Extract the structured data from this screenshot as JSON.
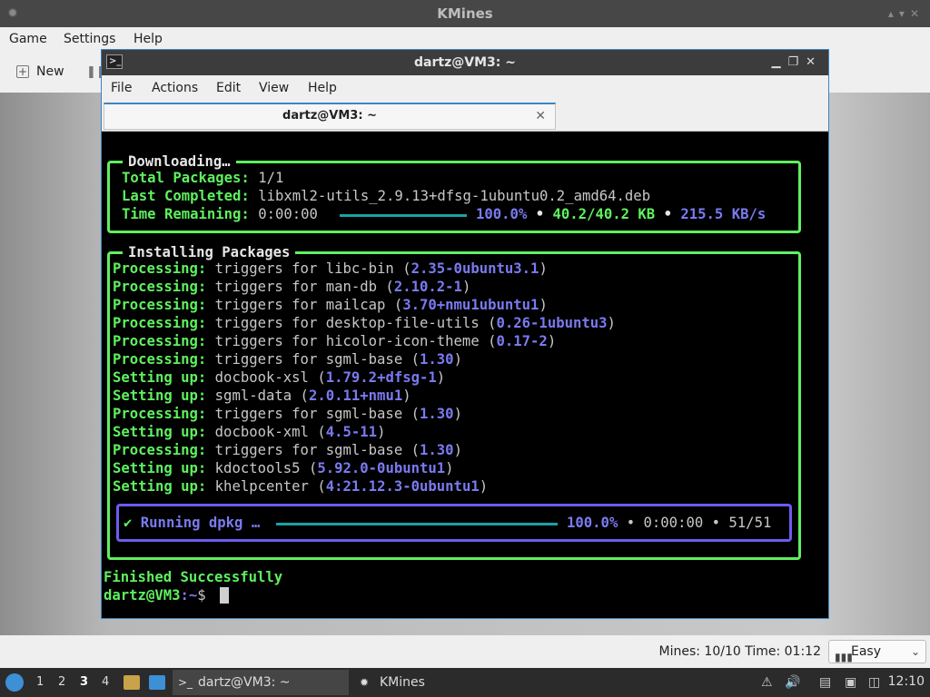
{
  "kmines": {
    "title": "KMines",
    "menu": [
      "Game",
      "Settings",
      "Help"
    ],
    "toolbar": {
      "new_label": "New"
    },
    "status": {
      "mines": "Mines: 10/10",
      "time": "Time: 01:12",
      "difficulty": "Easy"
    }
  },
  "terminal": {
    "title": "dartz@VM3: ~",
    "menu": [
      "File",
      "Actions",
      "Edit",
      "View",
      "Help"
    ],
    "tab_label": "dartz@VM3: ~",
    "download": {
      "title": "Downloading…",
      "total_label": "Total Packages:",
      "total_value": "1/1",
      "last_label": "Last Completed:",
      "last_value": "libxml2-utils_2.9.13+dfsg-1ubuntu0.2_amd64.deb",
      "remaining_label": "Time Remaining:",
      "remaining_value": "0:00:00",
      "percent": "100.0%",
      "size": "40.2/40.2 KB",
      "speed": "215.5 KB/s",
      "progress": 1.0
    },
    "install": {
      "title": "Installing Packages",
      "lines": [
        {
          "label": "Processing:",
          "text": "triggers for libc-bin (",
          "version": "2.35-0ubuntu3.1",
          "close": ")"
        },
        {
          "label": "Processing:",
          "text": "triggers for man-db (",
          "version": "2.10.2-1",
          "close": ")"
        },
        {
          "label": "Processing:",
          "text": "triggers for mailcap (",
          "version": "3.70+nmu1ubuntu1",
          "close": ")"
        },
        {
          "label": "Processing:",
          "text": "triggers for desktop-file-utils (",
          "version": "0.26-1ubuntu3",
          "close": ")"
        },
        {
          "label": "Processing:",
          "text": "triggers for hicolor-icon-theme (",
          "version": "0.17-2",
          "close": ")"
        },
        {
          "label": "Processing:",
          "text": "triggers for sgml-base (",
          "version": "1.30",
          "close": ")"
        },
        {
          "label": "Setting up:",
          "text": "docbook-xsl (",
          "version": "1.79.2+dfsg-1",
          "close": ")"
        },
        {
          "label": "Setting up:",
          "text": "sgml-data (",
          "version": "2.0.11+nmu1",
          "close": ")"
        },
        {
          "label": "Processing:",
          "text": "triggers for sgml-base (",
          "version": "1.30",
          "close": ")"
        },
        {
          "label": "Setting up:",
          "text": "docbook-xml (",
          "version": "4.5-11",
          "close": ")"
        },
        {
          "label": "Processing:",
          "text": "triggers for sgml-base (",
          "version": "1.30",
          "close": ")"
        },
        {
          "label": "Setting up:",
          "text": "kdoctools5 (",
          "version": "5.92.0-0ubuntu1",
          "close": ")"
        },
        {
          "label": "Setting up:",
          "text": "khelpcenter (",
          "version": "4:21.12.3-0ubuntu1",
          "close": ")"
        }
      ],
      "dpkg": {
        "check": "✔",
        "label": "Running dpkg …",
        "percent": "100.0%",
        "time": "0:00:00",
        "count": "51/51",
        "progress": 1.0
      }
    },
    "finished": "Finished Successfully",
    "prompt_user": "dartz@VM3",
    "prompt_path": ":~",
    "prompt_symbol": "$"
  },
  "taskbar": {
    "workspaces": [
      "1",
      "2",
      "3",
      "4"
    ],
    "active_workspace": "3",
    "tasks": [
      {
        "label": "dartz@VM3: ~",
        "icon": "terminal-icon"
      },
      {
        "label": "KMines",
        "icon": "kmines-icon"
      }
    ],
    "clock": "12:10"
  }
}
